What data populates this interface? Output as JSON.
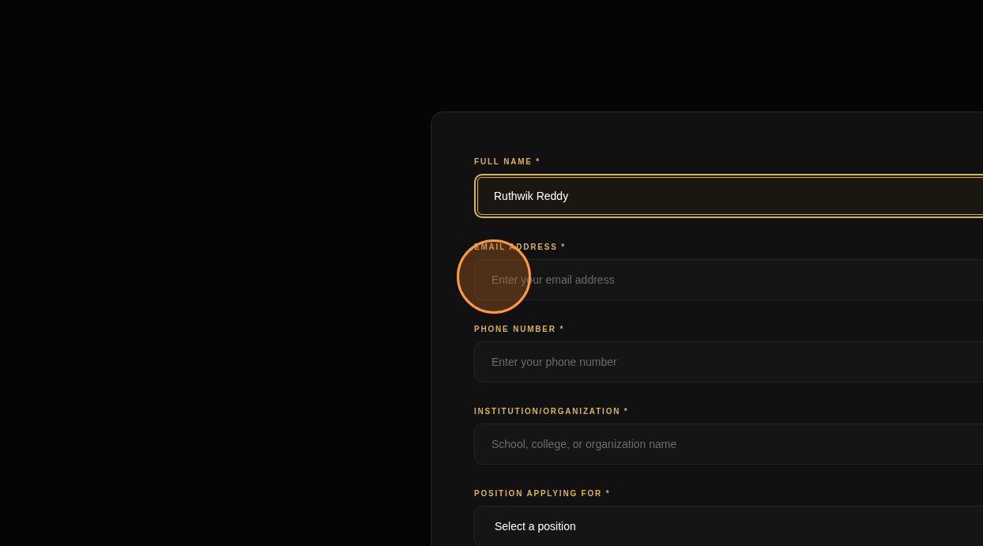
{
  "form": {
    "fields": [
      {
        "kind": "text",
        "label": "FULL NAME *",
        "value": "Ruthwik Reddy",
        "focused": true
      },
      {
        "kind": "text",
        "label": "EMAIL ADDRESS *",
        "placeholder": "Enter your email address",
        "focused": false
      },
      {
        "kind": "text",
        "label": "PHONE NUMBER *",
        "placeholder": "Enter your phone number",
        "focused": false
      },
      {
        "kind": "text",
        "label": "INSTITUTION/ORGANIZATION *",
        "placeholder": "School, college, or organization name",
        "focused": false
      },
      {
        "kind": "select",
        "label": "POSITION APPLYING FOR *",
        "value": "Select a position",
        "focused": false
      }
    ]
  }
}
